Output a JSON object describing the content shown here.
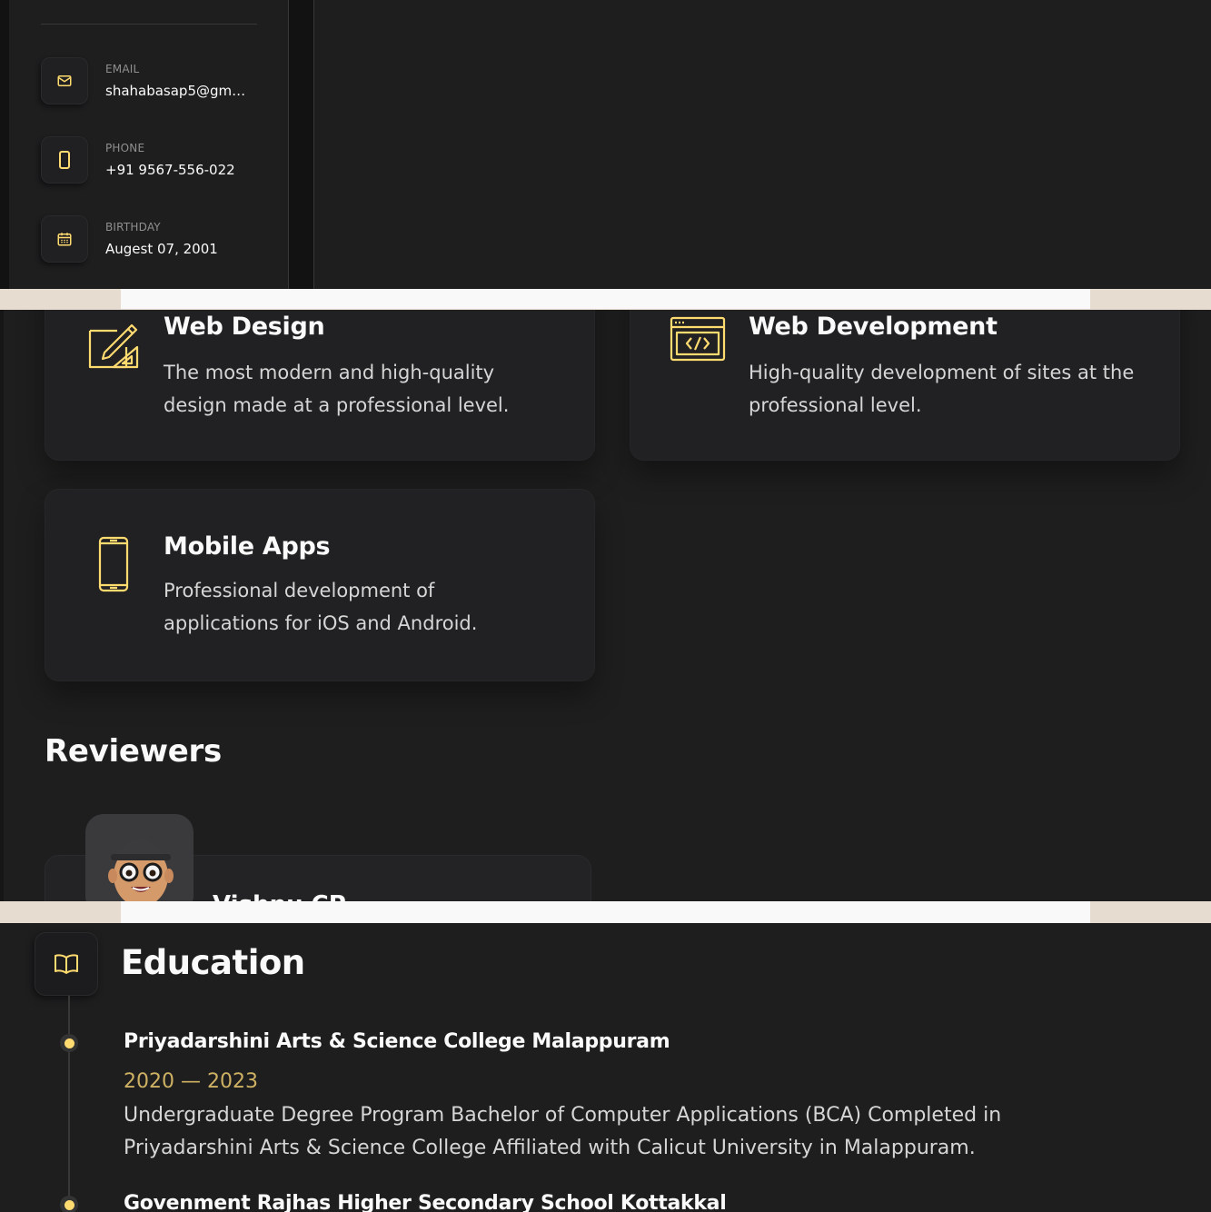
{
  "contacts": [
    {
      "label": "EMAIL",
      "value": "shahabasap5@gm…",
      "icon": "mail-icon"
    },
    {
      "label": "PHONE",
      "value": "+91 9567-556-022",
      "icon": "phone-icon"
    },
    {
      "label": "BIRTHDAY",
      "value": "Augest 07, 2001",
      "icon": "calendar-icon"
    }
  ],
  "services": [
    {
      "title": "Web Design",
      "text": "The most modern and high-quality design made at a professional level.",
      "icon": "design-icon"
    },
    {
      "title": "Web Development",
      "text": "High-quality development of sites at the professional level.",
      "icon": "code-icon"
    },
    {
      "title": "Mobile Apps",
      "text": "Professional development of applications for iOS and Android.",
      "icon": "mobile-icon"
    }
  ],
  "reviewers": {
    "title": "Reviewers",
    "items": [
      {
        "name": "Vishnu CP"
      }
    ]
  },
  "education": {
    "title": "Education",
    "icon": "book-icon",
    "items": [
      {
        "name": "Priyadarshini Arts & Science College Malappuram",
        "years": "2020 — 2023",
        "text": "Undergraduate Degree Program Bachelor of Computer Applications (BCA) Completed in Priyadarshini Arts & Science College Affiliated with Calicut University in Malappuram."
      },
      {
        "name": "Govenment Rajhas Higher Secondary School Kottakkal",
        "years": "",
        "text": ""
      }
    ]
  },
  "colors": {
    "accent": "#ffdb70",
    "background": "#1e1e1f",
    "card": "#212123"
  }
}
